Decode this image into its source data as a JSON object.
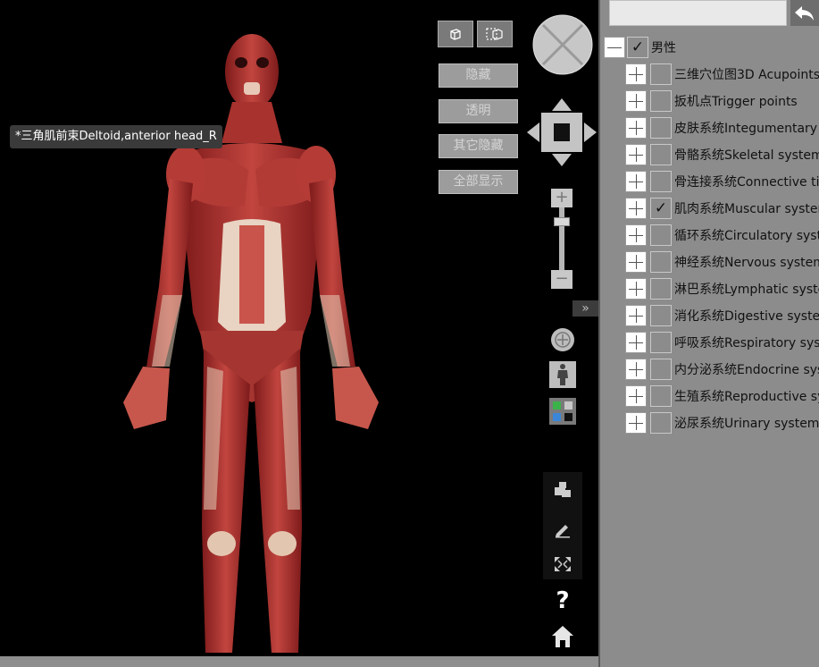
{
  "tooltip": "*三角肌前束Deltoid,anterior head_R",
  "view_buttons": {
    "view_single_icon": "cube-icon",
    "view_multi_icon": "multi-select-icon"
  },
  "actions": {
    "hide": "隐藏",
    "transparent": "透明",
    "hide_others": "其它隐藏",
    "show_all": "全部显示"
  },
  "zoom": {
    "plus": "+",
    "minus": "−"
  },
  "collapse_glyph": "»",
  "help_glyph": "?",
  "panel": {
    "search_value": "",
    "back_icon": "undo-arrow-icon",
    "root": {
      "label": "男性",
      "checked": "✓"
    },
    "items": [
      {
        "label": "三维穴位图3D Acupoints",
        "checked": ""
      },
      {
        "label": "扳机点Trigger points",
        "checked": ""
      },
      {
        "label": "皮肤系统Integumentary system",
        "checked": ""
      },
      {
        "label": "骨骼系统Skeletal system",
        "checked": ""
      },
      {
        "label": "骨连接系统Connective tissue",
        "checked": ""
      },
      {
        "label": "肌肉系统Muscular system",
        "checked": "✓"
      },
      {
        "label": "循环系统Circulatory system",
        "checked": ""
      },
      {
        "label": "神经系统Nervous system",
        "checked": ""
      },
      {
        "label": "淋巴系统Lymphatic system",
        "checked": ""
      },
      {
        "label": "消化系统Digestive system",
        "checked": ""
      },
      {
        "label": "呼吸系统Respiratory system",
        "checked": ""
      },
      {
        "label": "内分泌系统Endocrine system",
        "checked": ""
      },
      {
        "label": "生殖系统Reproductive system",
        "checked": ""
      },
      {
        "label": "泌尿系统Urinary system",
        "checked": ""
      }
    ]
  }
}
